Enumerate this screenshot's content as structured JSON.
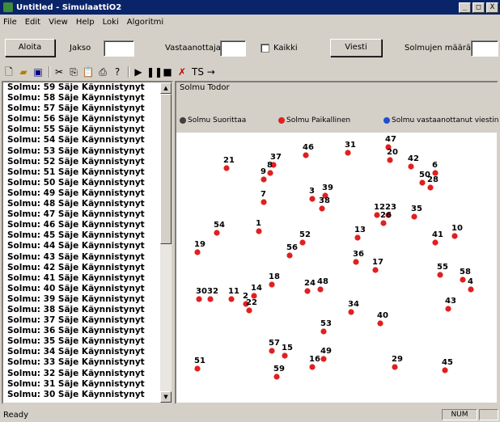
{
  "window": {
    "title": "Untitled - SimulaattiO2",
    "minimize": "_",
    "maximize": "□",
    "close": "X"
  },
  "menu": [
    "File",
    "Edit",
    "View",
    "Help",
    "Loki",
    "Algoritmi"
  ],
  "controls": {
    "start_button": "Aloita",
    "label_1": "Jakso",
    "value_1": "",
    "label_2": "Vastaanottaja",
    "value_2": "",
    "checkbox_label": "Kaikki",
    "action_button": "Viesti",
    "label_3": "Solmujen määrä",
    "value_3": ""
  },
  "toolbar_icons": [
    "new-file-icon",
    "open-folder-icon",
    "save-icon",
    "cut-icon",
    "copy-icon",
    "paste-icon",
    "print-icon",
    "help-icon",
    "play-icon",
    "pause-icon",
    "stop-icon",
    "reset-icon"
  ],
  "toolbar_ts": "TS →",
  "log": {
    "items": [
      "Solmu: 59 Säje Käynnistynyt",
      "Solmu: 58 Säje Käynnistynyt",
      "Solmu: 57 Säje Käynnistynyt",
      "Solmu: 56 Säje Käynnistynyt",
      "Solmu: 55 Säje Käynnistynyt",
      "Solmu: 54 Säje Käynnistynyt",
      "Solmu: 53 Säje Käynnistynyt",
      "Solmu: 52 Säje Käynnistynyt",
      "Solmu: 51 Säje Käynnistynyt",
      "Solmu: 50 Säje Käynnistynyt",
      "Solmu: 49 Säje Käynnistynyt",
      "Solmu: 48 Säje Käynnistynyt",
      "Solmu: 47 Säje Käynnistynyt",
      "Solmu: 46 Säje Käynnistynyt",
      "Solmu: 45 Säje Käynnistynyt",
      "Solmu: 44 Säje Käynnistynyt",
      "Solmu: 43 Säje Käynnistynyt",
      "Solmu: 42 Säje Käynnistynyt",
      "Solmu: 41 Säje Käynnistynyt",
      "Solmu: 40 Säje Käynnistynyt",
      "Solmu: 39 Säje Käynnistynyt",
      "Solmu: 38 Säje Käynnistynyt",
      "Solmu: 37 Säje Käynnistynyt",
      "Solmu: 36 Säje Käynnistynyt",
      "Solmu: 35 Säje Käynnistynyt",
      "Solmu: 34 Säje Käynnistynyt",
      "Solmu: 33 Säje Käynnistynyt",
      "Solmu: 32 Säje Käynnistynyt",
      "Solmu: 31 Säje Käynnistynyt",
      "Solmu: 30 Säje Käynnistynyt"
    ]
  },
  "simulation": {
    "title": "Solmu Todor",
    "legend": [
      {
        "label": "Solmu Suorittaa",
        "color": "#404040"
      },
      {
        "label": "Solmu Paikallinen",
        "color": "#e02020"
      },
      {
        "label": "Solmu vastaanottanut viestin",
        "color": "#2050d0"
      }
    ],
    "node_color": "#e02020",
    "node_labels": [
      "47",
      "46",
      "31",
      "20",
      "42",
      "6",
      "21",
      "37",
      "8",
      "9",
      "50",
      "28",
      "39",
      "3",
      "38",
      "7",
      "12",
      "23",
      "26",
      "35",
      "10",
      "54",
      "1",
      "13",
      "41",
      "19",
      "52",
      "56",
      "36",
      "17",
      "55",
      "58",
      "4",
      "18",
      "30",
      "32",
      "11",
      "2",
      "24",
      "48",
      "22",
      "14",
      "43",
      "34",
      "40",
      "53",
      "57",
      "15",
      "49",
      "16",
      "51",
      "29",
      "45",
      "59"
    ]
  },
  "status": {
    "text": "Ready",
    "panel_1": "NUM",
    "panel_2": ""
  }
}
